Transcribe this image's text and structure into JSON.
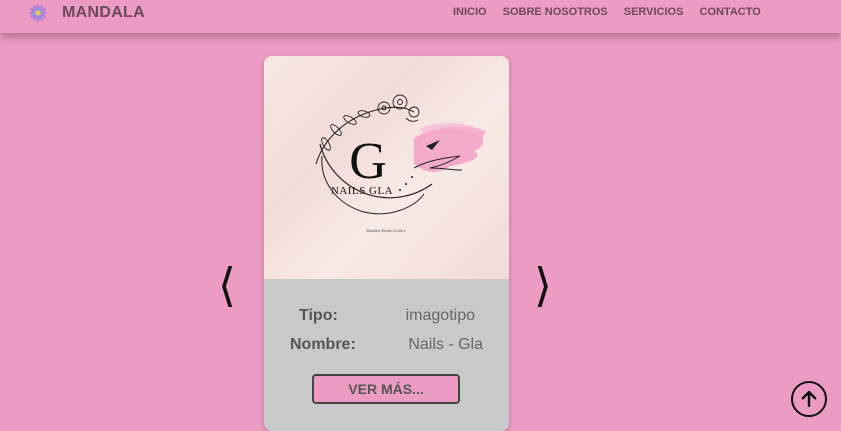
{
  "brand": {
    "name": "MANDALA",
    "logo_icon": "mandala-flower-icon"
  },
  "nav": {
    "items": [
      {
        "label": "INICIO"
      },
      {
        "label": "SOBRE NOSOTROS"
      },
      {
        "label": "SERVICIOS"
      },
      {
        "label": "CONTACTO"
      }
    ]
  },
  "carousel": {
    "prev_icon": "chevron-left-icon",
    "next_icon": "chevron-right-icon",
    "prev_glyph": "⟨",
    "next_glyph": "⟩"
  },
  "card": {
    "logo_letter": "G",
    "logo_text": "NAILS GLA",
    "logo_caption": "Mandala Diseño Gráfico",
    "tipo_label": "Tipo:",
    "tipo_value": "imagotipo",
    "nombre_label": "Nombre:",
    "nombre_value": "Nails - Gla",
    "button_label": "VER MÁS..."
  },
  "scroll_top": {
    "icon": "arrow-up-icon"
  },
  "colors": {
    "background": "#ec9bc2",
    "card_body": "#c9c9c9",
    "brush_pink": "#f3a3c8",
    "text": "#555555"
  }
}
